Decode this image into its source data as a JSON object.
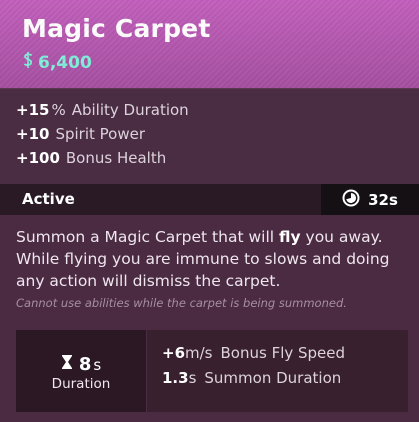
{
  "item": {
    "title": "Magic Carpet",
    "cost_icon": "souls-currency-icon",
    "cost": "6,400"
  },
  "stats": [
    {
      "value": "+15",
      "unit": "%",
      "label": "Ability Duration"
    },
    {
      "value": "+10",
      "unit": "",
      "label": "Spirit Power"
    },
    {
      "value": "+100",
      "unit": "",
      "label": "Bonus Health"
    }
  ],
  "active": {
    "label": "Active",
    "cooldown_icon": "cooldown-clock-icon",
    "cooldown": "32s"
  },
  "description": {
    "part1": "Summon a Magic Carpet that will ",
    "bold": "fly",
    "part2": " you away. While flying you are immune to slows and doing any action will dismiss the carpet.",
    "note": "Cannot use abilities while the carpet is being summoned."
  },
  "panel": {
    "duration_icon": "hourglass-icon",
    "duration_value": "8",
    "duration_unit": "s",
    "duration_label": "Duration",
    "stats": [
      {
        "value": "+6",
        "unit": "m/s",
        "label": "Bonus Fly Speed"
      },
      {
        "value": "1.3",
        "unit": "s",
        "label": "Summon Duration"
      }
    ]
  },
  "colors": {
    "header": "#c25fbc",
    "cost": "#7ff0d8",
    "background": "#4a2b42"
  }
}
